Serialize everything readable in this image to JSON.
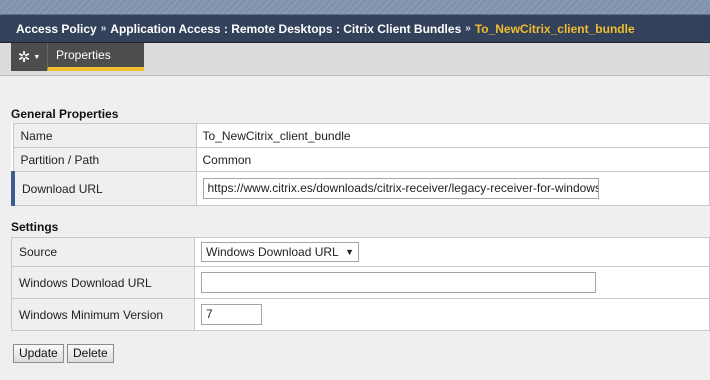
{
  "breadcrumb": {
    "items": [
      "Access Policy",
      "Application Access : Remote Desktops : Citrix Client Bundles"
    ],
    "separator": "»",
    "current": "To_NewCitrix_client_bundle"
  },
  "tabs": {
    "active": "Properties"
  },
  "general": {
    "title": "General Properties",
    "name_label": "Name",
    "name_value": "To_NewCitrix_client_bundle",
    "partition_label": "Partition / Path",
    "partition_value": "Common",
    "download_label": "Download URL",
    "download_value": "https://www.citrix.es/downloads/citrix-receiver/legacy-receiver-for-windows"
  },
  "settings": {
    "title": "Settings",
    "source_label": "Source",
    "source_value": "Windows Download URL",
    "win_url_label": "Windows Download URL",
    "win_url_value": "",
    "win_min_label": "Windows Minimum Version",
    "win_min_value": "7"
  },
  "buttons": {
    "update": "Update",
    "delete": "Delete"
  },
  "colors": {
    "header_bg": "#33415a",
    "accent_yellow": "#f2c12e",
    "current_crumb": "#f1bd2f"
  }
}
